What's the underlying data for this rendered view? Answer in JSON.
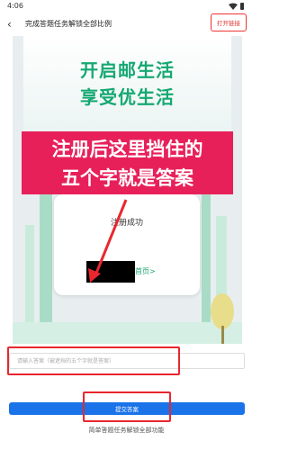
{
  "status_bar": {
    "time": "4:06"
  },
  "header": {
    "title": "完成答题任务解锁全部比例",
    "open_link_label": "打开链接"
  },
  "poster": {
    "headline_1": "开启邮生活",
    "headline_2": "享受优生活",
    "banner_line_1": "注册后这里挡住的",
    "banner_line_2": "五个字就是答案",
    "card_title": "注册成功",
    "card_link": "首页>"
  },
  "answer_field": {
    "placeholder": "请输入答案（被遮挡的五个字就是答案）",
    "value": ""
  },
  "submit_label": "提交答案",
  "footer_text": "简单答题任务解锁全部功能",
  "colors": {
    "accent_blue": "#1a73e8",
    "highlight_red": "#e8272e",
    "headline_green": "#16a872",
    "banner_pink": "#e8205a"
  }
}
